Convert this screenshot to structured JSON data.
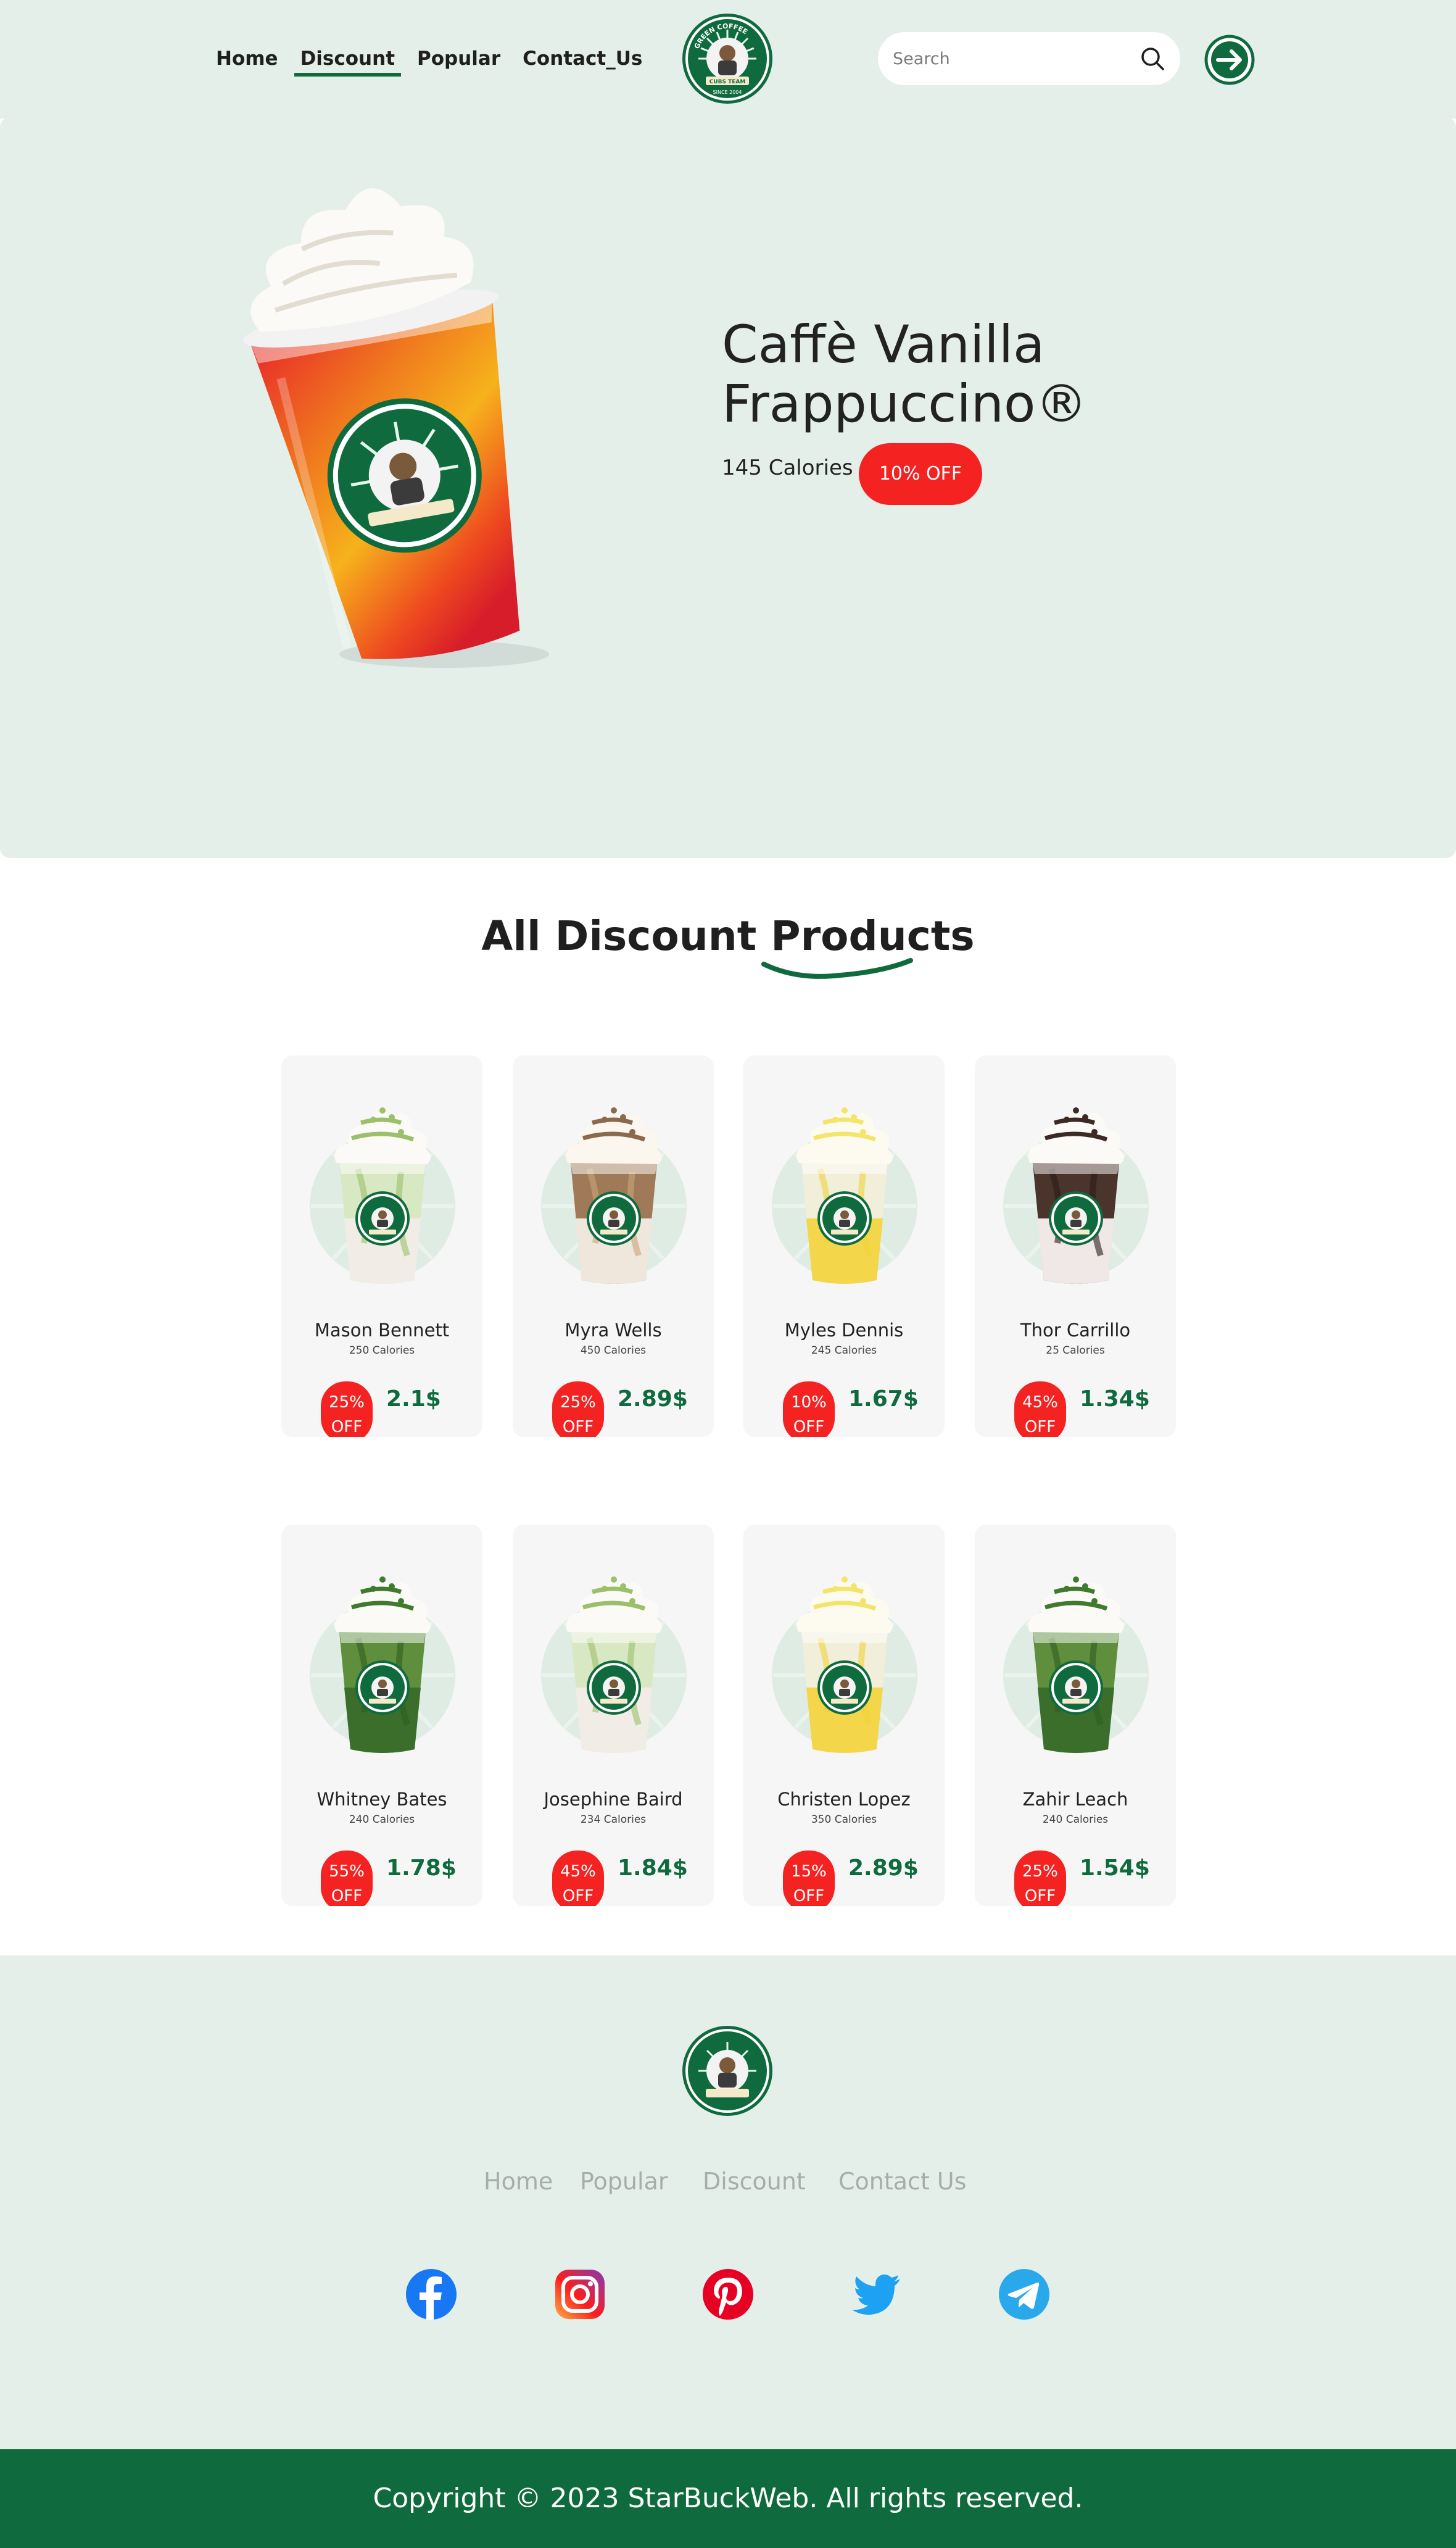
{
  "nav": {
    "items": [
      {
        "label": "Home"
      },
      {
        "label": "Discount",
        "active": true
      },
      {
        "label": "Popular"
      },
      {
        "label": "Contact_Us"
      }
    ]
  },
  "brand": {
    "logo_text": "GREEN COFFEE",
    "logo_sub": "CUBS TEAM",
    "logo_since": "SINCE 2004"
  },
  "search": {
    "placeholder": "Search"
  },
  "icons": {
    "search": "search-icon",
    "login": "arrow-right-circle-icon"
  },
  "colors": {
    "accent": "#0f6b3d",
    "badge": "#f52222",
    "hero_bg": "#e5efea",
    "card_bg": "#f6f6f6"
  },
  "hero": {
    "title": "Caffè Vanilla Frappuccino®",
    "calories": "145 Calories",
    "badge": "10% OFF"
  },
  "section": {
    "title": "All Discount Products"
  },
  "products": [
    {
      "name": "Mason Bennett",
      "calories": "250 Calories",
      "off_pct": "25%",
      "off_label": "OFF",
      "price": "2.1$",
      "flavor": "matcha"
    },
    {
      "name": "Myra Wells",
      "calories": "450 Calories",
      "off_pct": "25%",
      "off_label": "OFF",
      "price": "2.89$",
      "flavor": "mocha"
    },
    {
      "name": "Myles Dennis",
      "calories": "245 Calories",
      "off_pct": "10%",
      "off_label": "OFF",
      "price": "1.67$",
      "flavor": "lemon"
    },
    {
      "name": "Thor Carrillo",
      "calories": "25 Calories",
      "off_pct": "45%",
      "off_label": "OFF",
      "price": "1.34$",
      "flavor": "chocolate"
    },
    {
      "name": "Whitney Bates",
      "calories": "240 Calories",
      "off_pct": "55%",
      "off_label": "OFF",
      "price": "1.78$",
      "flavor": "dark-matcha"
    },
    {
      "name": "Josephine Baird",
      "calories": "234 Calories",
      "off_pct": "45%",
      "off_label": "OFF",
      "price": "1.84$",
      "flavor": "matcha"
    },
    {
      "name": "Christen Lopez",
      "calories": "350 Calories",
      "off_pct": "15%",
      "off_label": "OFF",
      "price": "2.89$",
      "flavor": "lemon"
    },
    {
      "name": "Zahir Leach",
      "calories": "240 Calories",
      "off_pct": "25%",
      "off_label": "OFF",
      "price": "1.54$",
      "flavor": "dark-matcha"
    }
  ],
  "footer": {
    "links": [
      {
        "label": "Home"
      },
      {
        "label": "Popular"
      },
      {
        "label": "Discount"
      },
      {
        "label": "Contact Us"
      }
    ],
    "social": [
      {
        "name": "facebook-icon"
      },
      {
        "name": "instagram-icon"
      },
      {
        "name": "pinterest-icon"
      },
      {
        "name": "twitter-icon"
      },
      {
        "name": "telegram-icon"
      }
    ],
    "copyright": "Copyright © 2023 StarBuckWeb. All rights reserved."
  }
}
